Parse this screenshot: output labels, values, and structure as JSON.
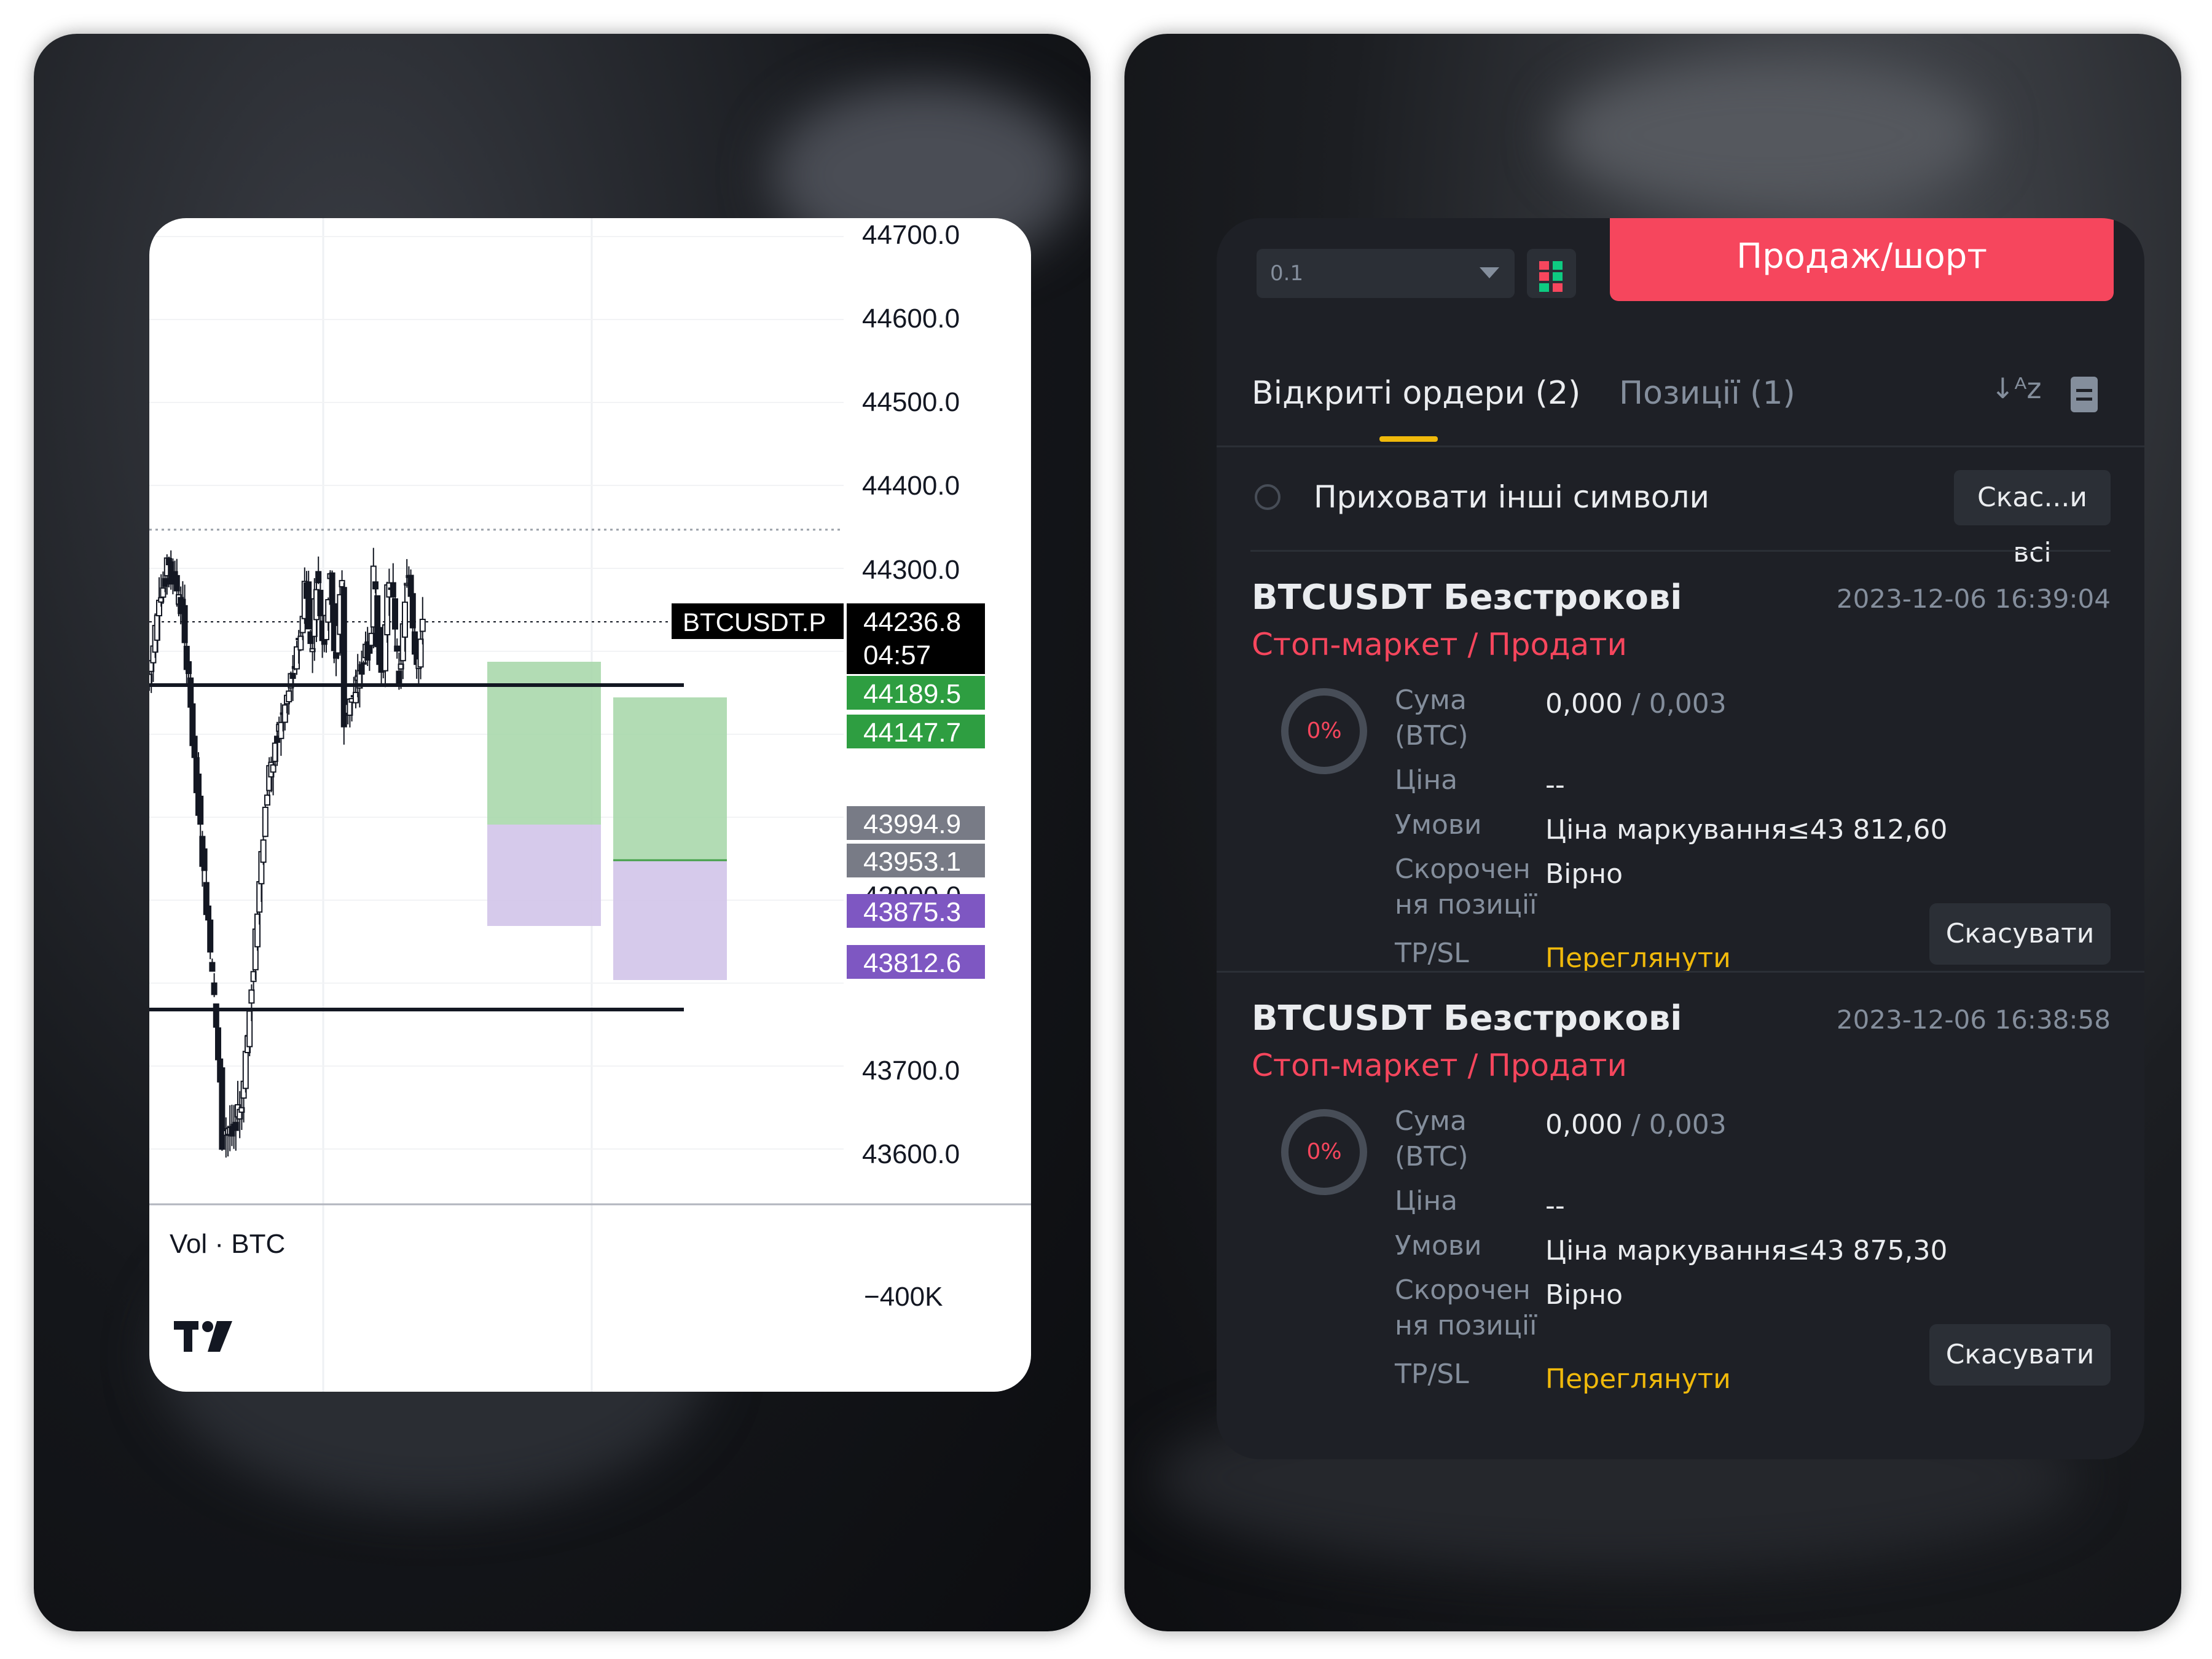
{
  "colors": {
    "up": "#131722",
    "accent_sell": "#f6465d",
    "accent_gold": "#f0b90b",
    "tp_green": "#43a047",
    "sl_purple": "#7e57c2",
    "panel_bg": "#1e2026"
  },
  "chart": {
    "price_ticks": [
      "44700.0",
      "44600.0",
      "44500.0",
      "44400.0",
      "44300.0",
      "43700.0",
      "43600.0"
    ],
    "symbol_tag": "BTCUSDT.P",
    "last_price": "44236.8",
    "countdown": "04:57",
    "green_tags": [
      "44189.5",
      "44147.7"
    ],
    "gray_tags": [
      "43994.9",
      "43953.1"
    ],
    "partial_tag": "43900.0",
    "purple_tags": [
      "43875.3",
      "43812.6"
    ],
    "vol_label": "Vol · BTC",
    "vol_tick": "−400K",
    "logo_text": "TV"
  },
  "chart_data": {
    "type": "candlestick",
    "title": "",
    "ylim": [
      43550,
      44720
    ],
    "y_ticks": [
      44700,
      44600,
      44500,
      44400,
      44300,
      43700,
      43600
    ],
    "annotations": [
      {
        "label": "BTCUSDT.P",
        "value": 44236.8
      },
      {
        "label": "04:57",
        "value": 44236.8
      },
      {
        "value": 44189.5
      },
      {
        "value": 44147.7
      },
      {
        "value": 43994.9
      },
      {
        "value": 43953.1
      },
      {
        "value": 43900.0
      },
      {
        "value": 43875.3
      },
      {
        "value": 43812.6
      }
    ]
  },
  "trade": {
    "qty_value": "0.1",
    "sell_label": "Продаж/шорт",
    "tab_open": "Відкриті ордери (2)",
    "tab_positions": "Позиції (1)",
    "hide_symbols": "Приховати інші символи",
    "cancel_all": "Скас...и всі",
    "orders": [
      {
        "symbol": "BTCUSDT Безстрокові",
        "timestamp": "2023-12-06 16:39:04",
        "type": "Стоп-маркет / Продати",
        "fill": "0%",
        "amount_label_1": "Сума",
        "amount_label_2": "(BTC)",
        "amount_filled": "0,000",
        "amount_total": " / 0,003",
        "price_label": "Ціна",
        "price_value": "--",
        "cond_label": "Умови",
        "cond_value": "Ціна маркування≤43 812,60",
        "reduce_label_1": "Скорочен",
        "reduce_label_2": "ня позиції",
        "reduce_value": "Вірно",
        "tpsl_label": "TP/SL",
        "tpsl_value": "Переглянути",
        "cancel": "Скасувати"
      },
      {
        "symbol": "BTCUSDT Безстрокові",
        "timestamp": "2023-12-06 16:38:58",
        "type": "Стоп-маркет / Продати",
        "fill": "0%",
        "amount_label_1": "Сума",
        "amount_label_2": "(BTC)",
        "amount_filled": "0,000",
        "amount_total": " / 0,003",
        "price_label": "Ціна",
        "price_value": "--",
        "cond_label": "Умови",
        "cond_value": "Ціна маркування≤43 875,30",
        "reduce_label_1": "Скорочен",
        "reduce_label_2": "ня позиції",
        "reduce_value": "Вірно",
        "tpsl_label": "TP/SL",
        "tpsl_value": "Переглянути",
        "cancel": "Скасувати"
      }
    ]
  }
}
